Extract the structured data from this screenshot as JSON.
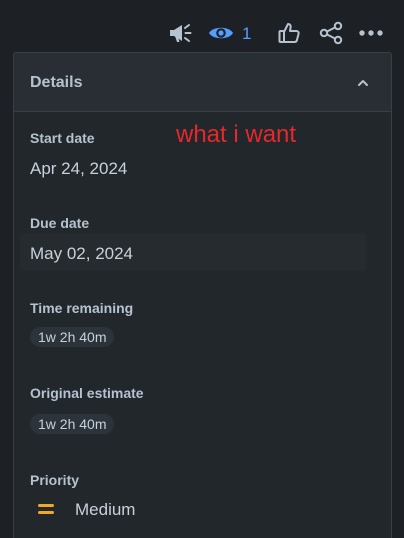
{
  "toolbar": {
    "watchers_count": "1",
    "icons": [
      "megaphone-icon",
      "eye-icon",
      "thumbs-up-icon",
      "share-icon",
      "more-icon"
    ]
  },
  "details": {
    "title": "Details",
    "annotation": "what i want",
    "start_date": {
      "label": "Start date",
      "value": "Apr 24, 2024"
    },
    "due_date": {
      "label": "Due date",
      "value": "May 02, 2024"
    },
    "time_remaining": {
      "label": "Time remaining",
      "value": "1w 2h 40m"
    },
    "original_estimate": {
      "label": "Original estimate",
      "value": "1w 2h 40m"
    },
    "priority": {
      "label": "Priority",
      "value": "Medium",
      "icon": "priority-medium-icon",
      "color": "#f5a623"
    }
  },
  "colors": {
    "background": "#1d2125",
    "panel": "#22272b",
    "accent": "#579dff",
    "annotation": "#e5282b"
  }
}
